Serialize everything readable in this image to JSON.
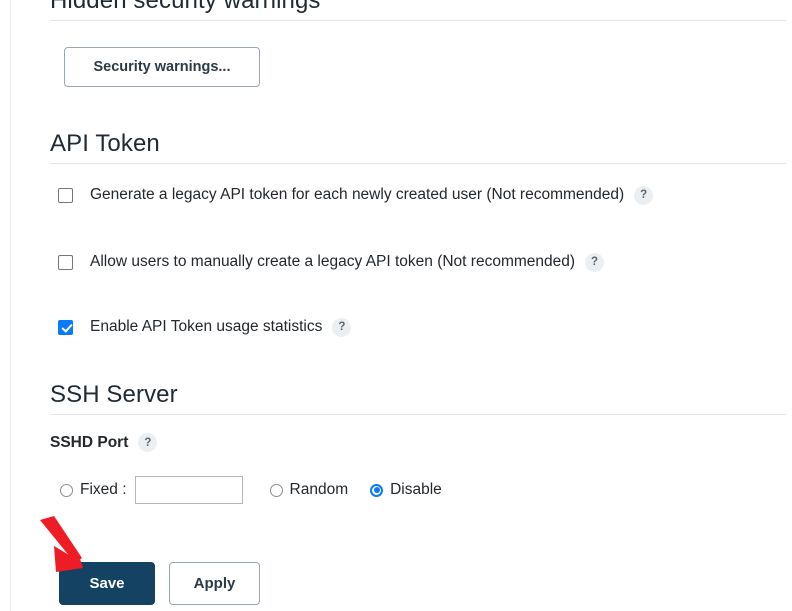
{
  "sections": {
    "hidden_warnings": {
      "heading": "Hidden security warnings",
      "button_label": "Security warnings..."
    },
    "api_token": {
      "heading": "API Token",
      "options": [
        {
          "label": "Generate a legacy API token for each newly created user (Not recommended)",
          "checked": false,
          "help": "?"
        },
        {
          "label": "Allow users to manually create a legacy API token (Not recommended)",
          "checked": false,
          "help": "?"
        },
        {
          "label": "Enable API Token usage statistics",
          "checked": true,
          "help": "?"
        }
      ]
    },
    "ssh_server": {
      "heading": "SSH Server",
      "port_label": "SSHD Port",
      "port_help": "?",
      "radios": [
        {
          "label": "Fixed :",
          "selected": false
        },
        {
          "label": "Random",
          "selected": false
        },
        {
          "label": "Disable",
          "selected": true
        }
      ],
      "port_value": "",
      "port_placeholder": ""
    }
  },
  "footer": {
    "save_label": "Save",
    "apply_label": "Apply"
  },
  "annotation": {
    "arrow_color": "#ee1c24",
    "points_to": "Save"
  },
  "colors": {
    "primary_button": "#134263",
    "checkbox_checked": "#0a7af5",
    "radio_selected": "#0a7af5",
    "heading_text": "#1f2a33",
    "rule": "#e4e6e8"
  }
}
